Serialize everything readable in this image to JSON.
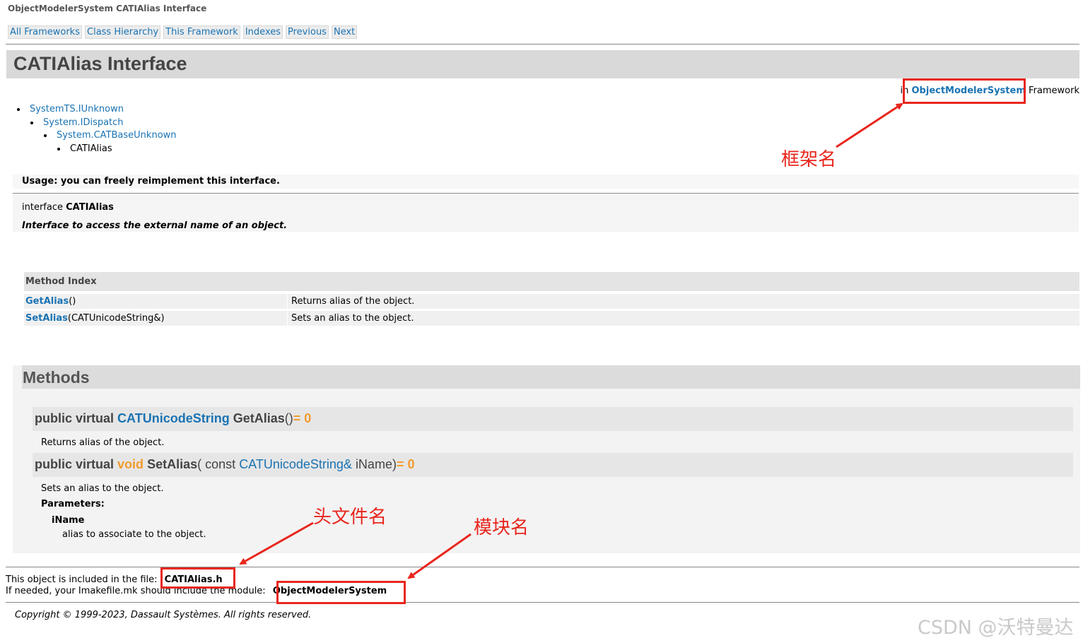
{
  "header": {
    "doc_title": "ObjectModelerSystem CATIAlias Interface",
    "nav": [
      "All Frameworks",
      "Class Hierarchy",
      "This Framework",
      "Indexes",
      "Previous",
      "Next"
    ]
  },
  "page_title": "CATIAlias Interface",
  "framework": {
    "prefix": "in",
    "name": "ObjectModelerSystem",
    "suffix": "Framework"
  },
  "hierarchy": [
    "SystemTS.IUnknown",
    "System.IDispatch",
    "System.CATBaseUnknown",
    "CATIAlias"
  ],
  "usage": "Usage: you can freely reimplement this interface.",
  "declaration": {
    "prefix": "interface",
    "name": "CATIAlias",
    "description": "Interface to access the external name of an object."
  },
  "method_index": {
    "heading": "Method Index",
    "rows": [
      {
        "name": "GetAlias",
        "args": "()",
        "desc": "Returns alias of the object."
      },
      {
        "name": "SetAlias",
        "args": "(CATUnicodeString&)",
        "desc": "Sets an alias to the object."
      }
    ]
  },
  "methods": {
    "heading": "Methods",
    "getalias": {
      "modifiers": "public virtual",
      "ret": "CATUnicodeString",
      "name": "GetAlias",
      "args": "()",
      "pure": "= 0",
      "desc": "Returns alias of the object."
    },
    "setalias": {
      "modifiers": "public virtual",
      "ret": "void",
      "name": "SetAlias",
      "open": "(",
      "const_kw": "const",
      "param_type": "CATUnicodeString&",
      "param_name": "iName)",
      "pure": "= 0",
      "desc": "Sets an alias to the object.",
      "params_label": "Parameters:",
      "param": "iName",
      "param_desc": "alias to associate to the object."
    }
  },
  "footer": {
    "file_prefix": "This object is included in the file:",
    "file_name": "CATIAlias.h",
    "module_prefix": "If needed, your Imakefile.mk should include the module:",
    "module_name": "ObjectModelerSystem",
    "copyright": "Copyright © 1999-2023, Dassault Systèmes. All rights reserved."
  },
  "annotations": {
    "framework": "框架名",
    "header_file": "头文件名",
    "module": "模块名"
  },
  "watermark": "CSDN @沃特曼达",
  "colors": {
    "link": "#1a73b3",
    "keyword_orange": "#f29a2e",
    "annotation_red": "#e8261d"
  }
}
